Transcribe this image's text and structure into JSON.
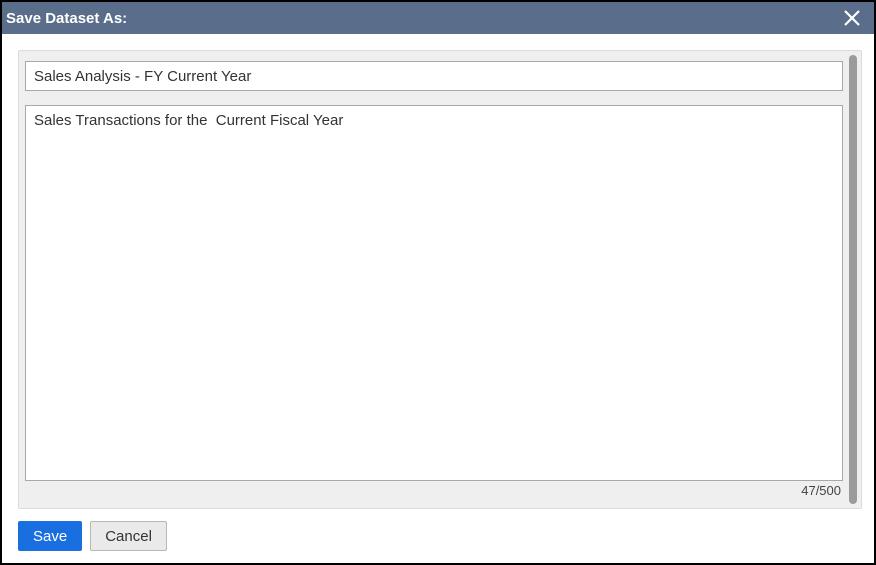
{
  "dialog": {
    "title": "Save Dataset As:"
  },
  "form": {
    "name_value": "Sales Analysis - FY Current Year",
    "description_value": "Sales Transactions for the  Current Fiscal Year",
    "char_counter": "47/500"
  },
  "buttons": {
    "save_label": "Save",
    "cancel_label": "Cancel"
  }
}
